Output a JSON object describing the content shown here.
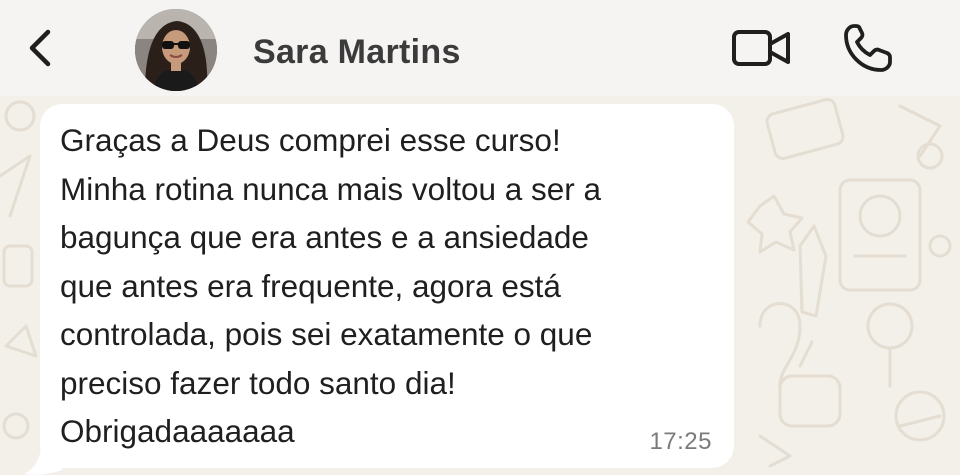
{
  "header": {
    "contact_name": "Sara Martins",
    "back_icon": "chevron-left-icon",
    "video_icon": "video-camera-icon",
    "call_icon": "phone-icon"
  },
  "message": {
    "text": "Graças a Deus comprei esse curso!\nMinha rotina nunca mais voltou a ser a\nbagunça que era antes e a ansiedade\nque antes era frequente, agora está\ncontrolada, pois sei exatamente o que\npreciso fazer todo santo dia!\nObrigadaaaaaaa",
    "time": "17:25"
  },
  "colors": {
    "header_bg": "#f5f4f2",
    "chat_bg": "#f3efe9",
    "bubble_bg": "#ffffff",
    "icon_color": "#1f1f1f"
  }
}
